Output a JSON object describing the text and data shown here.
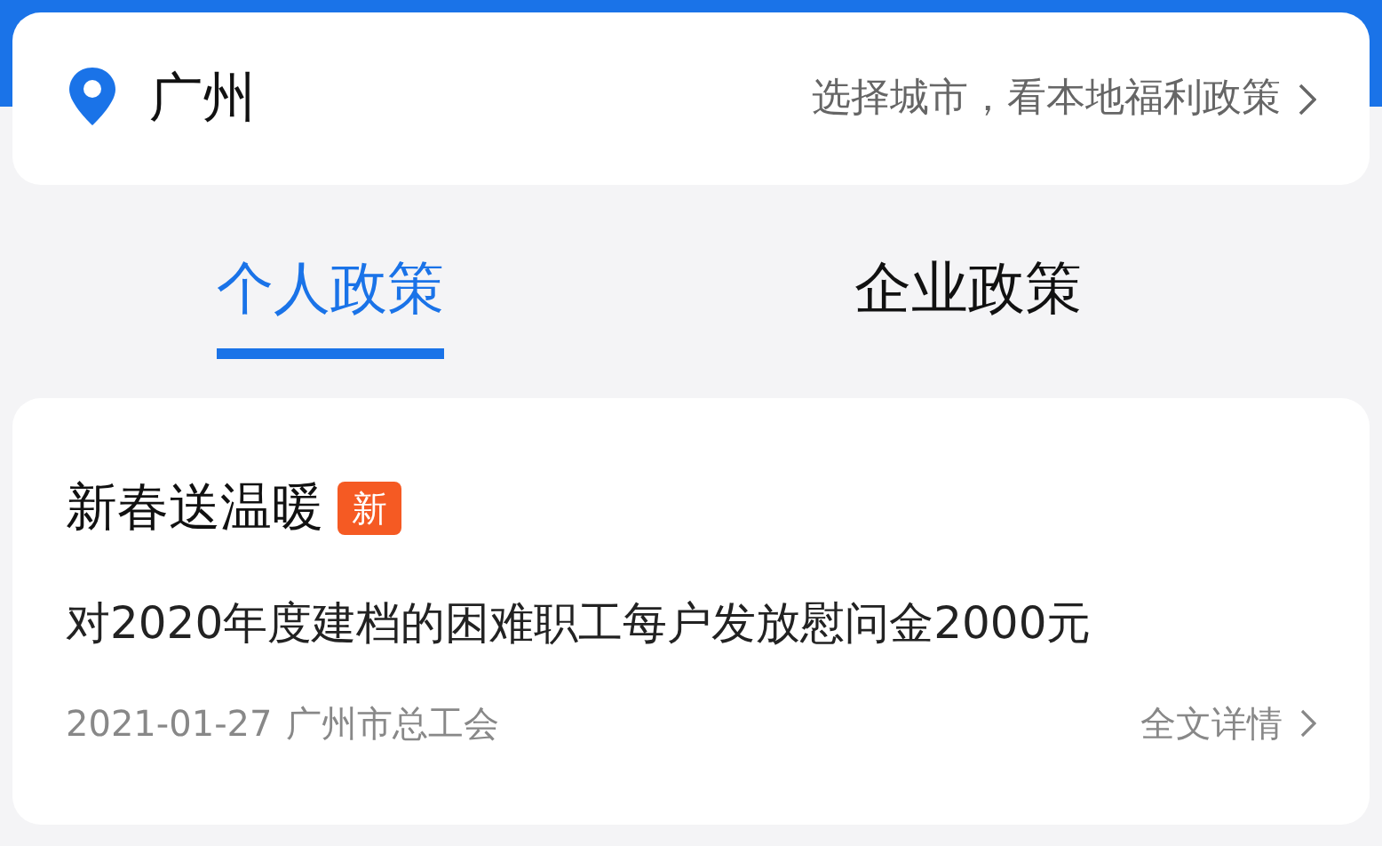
{
  "location": {
    "city": "广州",
    "hint": "选择城市，看本地福利政策"
  },
  "tabs": [
    {
      "label": "个人政策",
      "selected": true
    },
    {
      "label": "企业政策",
      "selected": false
    }
  ],
  "policies": [
    {
      "title": "新春送温暖",
      "badge": "新",
      "summary": "对2020年度建档的困难职工每户发放慰问金2000元",
      "date": "2021-01-27",
      "source": "广州市总工会",
      "link": "全文详情"
    }
  ]
}
